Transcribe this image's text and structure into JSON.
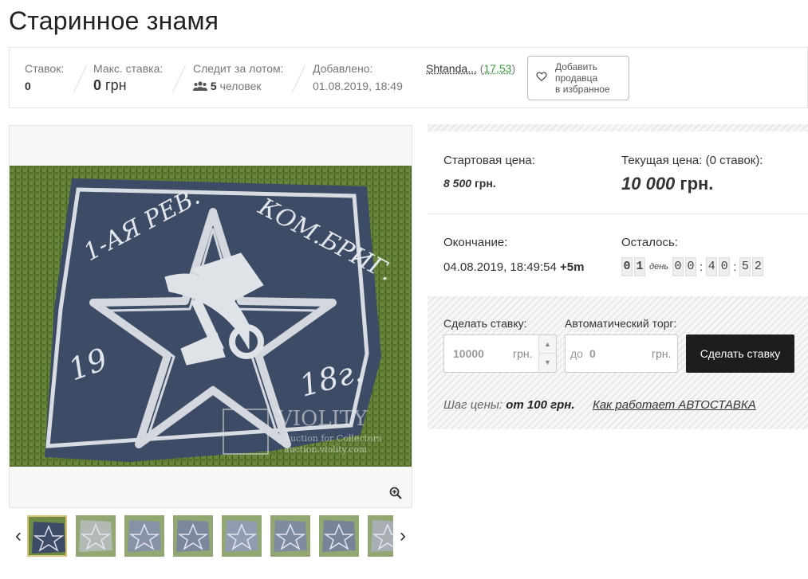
{
  "page": {
    "title": "Старинное знамя"
  },
  "info": {
    "bids_label": "Ставок:",
    "bids_value": "0",
    "max_bid_label": "Макс. ставка:",
    "max_bid_value": "0",
    "max_bid_unit": "грн",
    "watchers_label": "Следит за лотом:",
    "watchers_value": "5",
    "watchers_unit": "человек",
    "added_label": "Добавлено:",
    "added_value": "01.08.2019, 18:49",
    "seller_name": "Shtanda...",
    "seller_rating": "17,53",
    "fav_button_line1": "Добавить",
    "fav_button_line2": "продавца",
    "fav_button_line3": "в избранное"
  },
  "gallery": {
    "image_alt": "Старинное знамя",
    "flag_text_left": "1-АЯ РЕВ.",
    "flag_text_right": "КОМ.БРИГ.",
    "flag_year_left": "19",
    "flag_year_right": "18г.",
    "watermark_brand": "VIOLITY",
    "watermark_sub1": "Auction for Collectors",
    "watermark_sub2": "auction.violity.com",
    "thumbnail_count": 8,
    "active_thumbnail": 1
  },
  "price": {
    "start_label": "Стартовая цена:",
    "start_value": "8 500",
    "start_unit": "грн.",
    "current_label": "Текущая цена: (0 ставок):",
    "current_value": "10 000",
    "current_unit": "грн.",
    "end_label": "Окончание:",
    "end_value": "04.08.2019, 18:49:54",
    "end_tz": "+5m",
    "remaining_label": "Осталось:",
    "timer": {
      "days": [
        "0",
        "1"
      ],
      "day_word": "день",
      "hours": [
        "0",
        "0"
      ],
      "minutes": [
        "4",
        "0"
      ],
      "seconds": [
        "5",
        "2"
      ]
    }
  },
  "bid": {
    "make_bid_label": "Сделать ставку:",
    "bid_value": "10000",
    "bid_unit": "грн.",
    "auto_label": "Автоматический торг:",
    "auto_prefix": "до",
    "auto_value": "0",
    "auto_unit": "грн.",
    "submit_label": "Сделать ставку",
    "step_prefix": "Шаг цены:",
    "step_value": "от 100 грн.",
    "autobid_link": "Как работает АВТОСТАВКА"
  },
  "colors": {
    "accent_green": "#3a9d3a",
    "button_dark": "#1d1d1d",
    "flag_blue": "#3d4c66",
    "grass": "#4e6b2c"
  }
}
